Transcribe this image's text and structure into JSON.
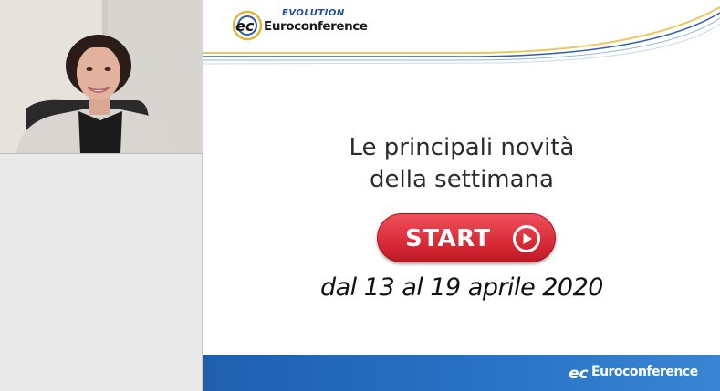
{
  "slide": {
    "logo": {
      "tagline": "EVOLUTION",
      "brand": "Euroconference"
    },
    "headline_line1": "Le principali novità",
    "headline_line2": "della settimana",
    "start_button": {
      "label": "START",
      "icon": "play-circle-icon",
      "color": "#d42632"
    },
    "date_range": "dal 13 al 19 aprile 2020",
    "footer": {
      "brand": "Euroconference",
      "color": "#1f5fae"
    }
  }
}
